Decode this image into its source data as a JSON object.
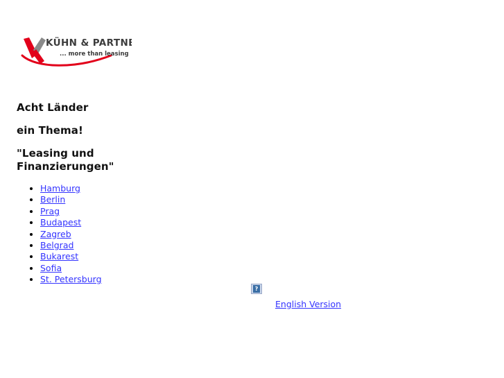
{
  "page": {
    "background_color": "#ffffff",
    "link_color": "#3333ff",
    "brand_red": "#e2001a",
    "brand_dark": "#3c3c3c"
  },
  "logo": {
    "mark_name": "kuehn-k-swoosh",
    "company_name": "KÜHN & PARTNER",
    "tagline": "... more than leasing"
  },
  "headings": [
    {
      "text": "Acht Länder"
    },
    {
      "text": "ein Thema!"
    },
    {
      "text": "\"Leasing und"
    },
    {
      "text": "Finanzierungen\""
    }
  ],
  "cities": [
    {
      "label": "Hamburg"
    },
    {
      "label": "Berlin"
    },
    {
      "label": "Prag"
    },
    {
      "label": "Budapest"
    },
    {
      "label": "Zagreb"
    },
    {
      "label": "Belgrad"
    },
    {
      "label": "Bukarest"
    },
    {
      "label": "Sofia"
    },
    {
      "label": "St. Petersburg"
    }
  ],
  "placeholder": {
    "icon_name": "broken-image-icon",
    "glyph": "?"
  },
  "footer": {
    "english_link": "English Version"
  }
}
